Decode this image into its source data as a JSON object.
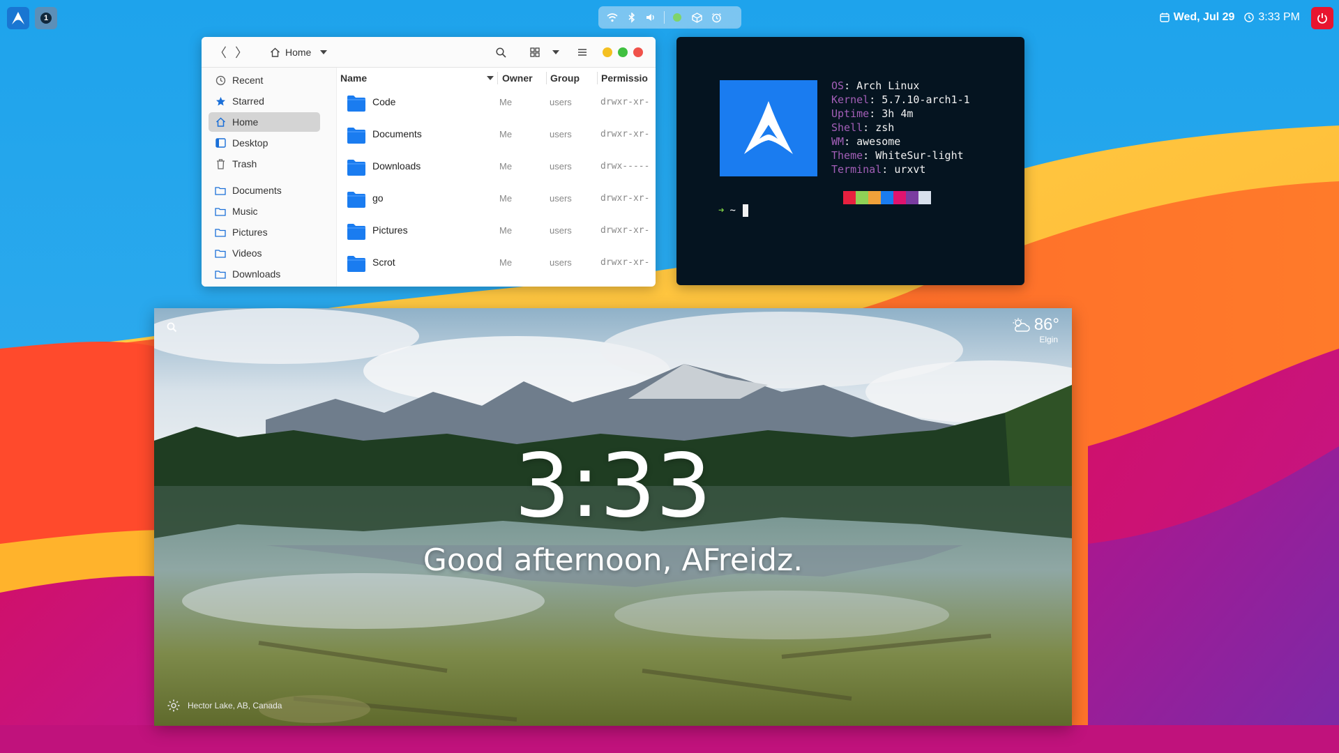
{
  "topbar": {
    "workspace_number": "1",
    "date": "Wed, Jul 29",
    "time": "3:33 PM",
    "tray_icons": [
      "wifi-icon",
      "bluetooth-icon",
      "volume-icon",
      "status-dot-icon",
      "package-icon",
      "alarm-icon"
    ]
  },
  "file_manager": {
    "location": "Home",
    "sidebar": [
      {
        "label": "Recent",
        "icon": "clock-icon"
      },
      {
        "label": "Starred",
        "icon": "star-icon"
      },
      {
        "label": "Home",
        "icon": "home-icon",
        "active": true
      },
      {
        "label": "Desktop",
        "icon": "desktop-icon"
      },
      {
        "label": "Trash",
        "icon": "trash-icon"
      },
      {
        "label": "Documents",
        "icon": "folder-icon"
      },
      {
        "label": "Music",
        "icon": "folder-icon"
      },
      {
        "label": "Pictures",
        "icon": "folder-icon"
      },
      {
        "label": "Videos",
        "icon": "folder-icon"
      },
      {
        "label": "Downloads",
        "icon": "folder-icon"
      }
    ],
    "columns": {
      "name": "Name",
      "owner": "Owner",
      "group": "Group",
      "permissions": "Permissio"
    },
    "files": [
      {
        "name": "Code",
        "owner": "Me",
        "group": "users",
        "perm": "drwxr-xr-"
      },
      {
        "name": "Documents",
        "owner": "Me",
        "group": "users",
        "perm": "drwxr-xr-"
      },
      {
        "name": "Downloads",
        "owner": "Me",
        "group": "users",
        "perm": "drwx-----"
      },
      {
        "name": "go",
        "owner": "Me",
        "group": "users",
        "perm": "drwxr-xr-"
      },
      {
        "name": "Pictures",
        "owner": "Me",
        "group": "users",
        "perm": "drwxr-xr-"
      },
      {
        "name": "Scrot",
        "owner": "Me",
        "group": "users",
        "perm": "drwxr-xr-"
      }
    ]
  },
  "terminal": {
    "info": [
      {
        "key": "OS",
        "value": "Arch Linux"
      },
      {
        "key": "Kernel",
        "value": "5.7.10-arch1-1"
      },
      {
        "key": "Uptime",
        "value": "3h 4m"
      },
      {
        "key": "Shell",
        "value": "zsh"
      },
      {
        "key": "WM",
        "value": "awesome"
      },
      {
        "key": "Theme",
        "value": "WhiteSur-light"
      },
      {
        "key": "Terminal",
        "value": "urxvt"
      }
    ],
    "swatches": [
      "#e8203f",
      "#8fd156",
      "#f0a13a",
      "#1a7cf0",
      "#e0136e",
      "#7a3ca0",
      "#d8e0ec"
    ],
    "prompt_symbol": "➜",
    "prompt_dir": "~"
  },
  "startpage": {
    "clock": "3:33",
    "greeting": "Good afternoon, AFreidz.",
    "temperature": "86°",
    "city": "Elgin",
    "location": "Hector Lake, AB, Canada"
  },
  "colors": {
    "accent_blue": "#1976d2",
    "power_red": "#e8152f",
    "folder_blue": "#1a7cf0",
    "terminal_bg": "#051420"
  }
}
